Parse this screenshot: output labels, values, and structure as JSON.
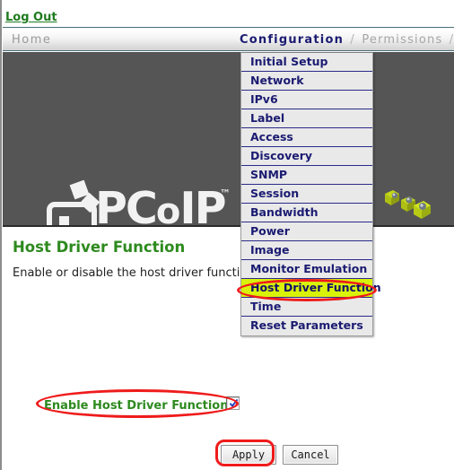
{
  "topbar": {
    "logout_label": "Log Out"
  },
  "nav": {
    "home_label": "Home",
    "current_label": "Configuration",
    "separator": "/",
    "permissions_label": "Permissions",
    "trailing_separator": "/"
  },
  "banner": {
    "logo_text_pc": "PC",
    "logo_text_o": "o",
    "logo_text_ip": "IP",
    "logo_tm": "™"
  },
  "menu": {
    "items": [
      {
        "label": "Initial Setup",
        "selected": false
      },
      {
        "label": "Network",
        "selected": false
      },
      {
        "label": "IPv6",
        "selected": false
      },
      {
        "label": "Label",
        "selected": false
      },
      {
        "label": "Access",
        "selected": false
      },
      {
        "label": "Discovery",
        "selected": false
      },
      {
        "label": "SNMP",
        "selected": false
      },
      {
        "label": "Session",
        "selected": false
      },
      {
        "label": "Bandwidth",
        "selected": false
      },
      {
        "label": "Power",
        "selected": false
      },
      {
        "label": "Image",
        "selected": false
      },
      {
        "label": "Monitor Emulation",
        "selected": false
      },
      {
        "label": "Host Driver Function",
        "selected": true
      },
      {
        "label": "Time",
        "selected": false
      },
      {
        "label": "Reset Parameters",
        "selected": false
      }
    ]
  },
  "main": {
    "title": "Host Driver Function",
    "description": "Enable or disable the host driver function",
    "checkbox_label": "Enable Host Driver Function:",
    "checkbox_checked": true,
    "apply_label": "Apply",
    "cancel_label": "Cancel"
  },
  "colors": {
    "accent_green": "#2d8a1e",
    "nav_active_blue": "#1c1c72",
    "menu_text_blue": "#1b1b72",
    "highlight_yellow": "#d9f20a",
    "annotation_red": "#ef1b1b",
    "banner_gray": "#555555"
  }
}
